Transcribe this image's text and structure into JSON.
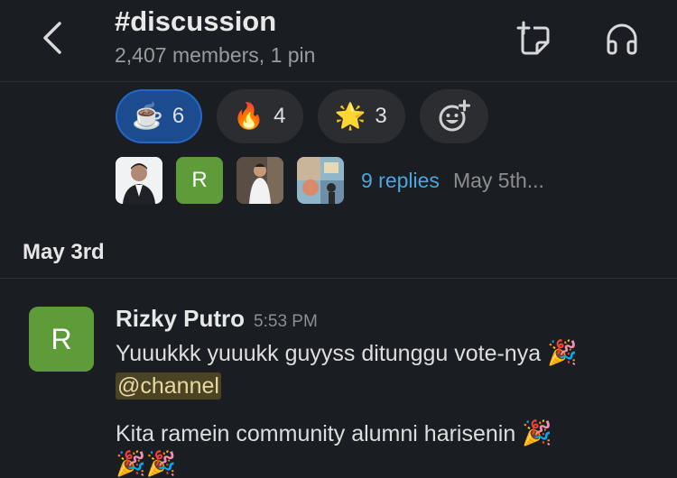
{
  "header": {
    "channel": "#discussion",
    "meta": "2,407 members, 1 pin"
  },
  "reactions": [
    {
      "emoji": "☕",
      "count": "6",
      "active": true
    },
    {
      "emoji": "🔥",
      "count": "4",
      "active": false
    },
    {
      "emoji": "🌟",
      "count": "3",
      "active": false
    }
  ],
  "thread": {
    "reply_avatar_letter": "R",
    "replies_label": "9 replies",
    "last_reply": "May 5th..."
  },
  "date_divider": "May 3rd",
  "message": {
    "avatar_letter": "R",
    "author": "Rizky Putro",
    "time": "5:53 PM",
    "line1": "Yuuukkk yuuukk guyyss ditunggu vote-nya",
    "mention": "@channel",
    "line3": "Kita ramein community alumni harisenin",
    "emoji_party": "🎉"
  },
  "colors": {
    "background": "#1a1d21",
    "active_reaction": "#1d4b8f",
    "link": "#4ea6dc",
    "avatar_green": "#5e9c3a"
  }
}
